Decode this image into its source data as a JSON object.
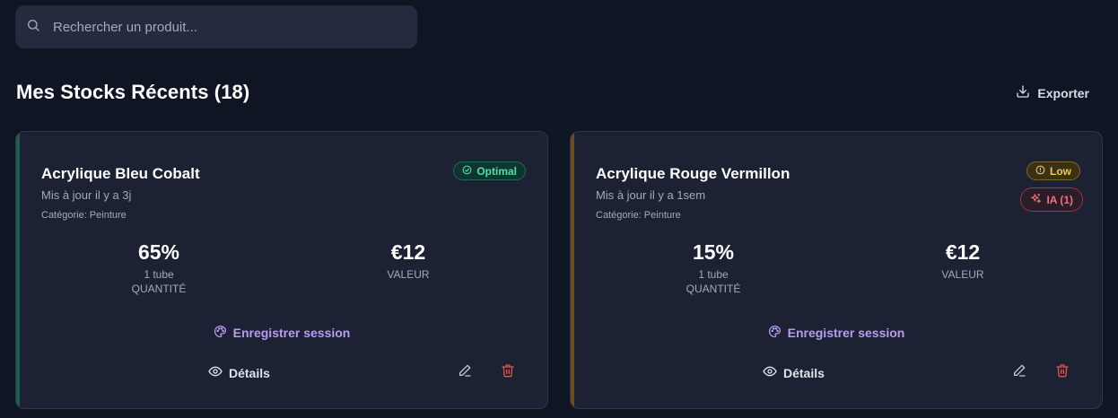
{
  "search": {
    "placeholder": "Rechercher un produit...",
    "value": ""
  },
  "section": {
    "title": "Mes Stocks Récents (18)",
    "export_label": "Exporter"
  },
  "cards": [
    {
      "name": "Acrylique Bleu Cobalt",
      "updated": "Mis à jour il y a 3j",
      "category": "Catégorie: Peinture",
      "status": "Optimal",
      "accent_color": "#1f5e4d",
      "quantity_percent": "65%",
      "quantity_sub": "1 tube",
      "quantity_label": "QUANTITÉ",
      "value": "€12",
      "value_label": "VALEUR",
      "session_label": "Enregistrer session",
      "details_label": "Détails"
    },
    {
      "name": "Acrylique Rouge Vermillon",
      "updated": "Mis à jour il y a 1sem",
      "category": "Catégorie: Peinture",
      "status": "Low",
      "ai_badge": "IA (1)",
      "accent_color": "#6b4e1e",
      "quantity_percent": "15%",
      "quantity_sub": "1 tube",
      "quantity_label": "QUANTITÉ",
      "value": "€12",
      "value_label": "VALEUR",
      "session_label": "Enregistrer session",
      "details_label": "Détails"
    }
  ],
  "colors": {
    "background": "#0f1523",
    "card": "#1c2233",
    "optimal": "#4ee0a8",
    "low": "#f2c94c",
    "ai": "#f07178",
    "session_link": "#b79cf2",
    "delete": "#e5534b"
  }
}
